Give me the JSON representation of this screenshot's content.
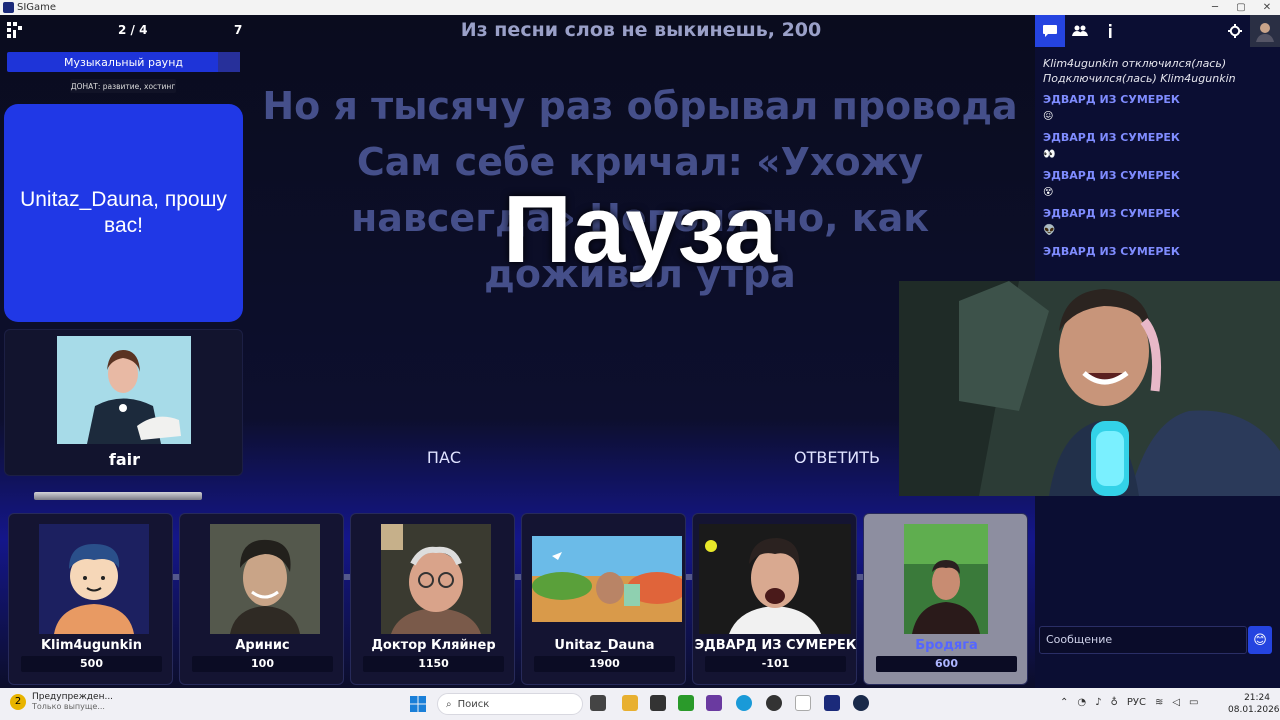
{
  "window": {
    "title": "SIGame"
  },
  "header": {
    "round_counter": "2 / 4",
    "round_total": "7",
    "theme_title": "Из песни слов не выкинешь, 200"
  },
  "left_panel": {
    "round_name": "Музыкальный раунд",
    "donate": "ДОНАТ: развитие, хостинг",
    "showman_message": "Unitaz_Dauna, прошу вас!",
    "showman_name": "fair"
  },
  "question": {
    "text": "Но я тысячу раз обрывал провода Сам себе кричал: «Ухожу навсегда» Непонятно, как доживал утра"
  },
  "overlay": {
    "pause": "Пауза"
  },
  "actions": {
    "pass_label": "ПАС",
    "answer_label": "ОТВЕТИТЬ"
  },
  "players": [
    {
      "name": "Klim4ugunkin",
      "score": "500"
    },
    {
      "name": "Аринис",
      "score": "100"
    },
    {
      "name": "Доктор Кляйнер",
      "score": "1150"
    },
    {
      "name": "Unitaz_Dauna",
      "score": "1900"
    },
    {
      "name": "ЭДВАРД ИЗ СУМЕРЕК",
      "score": "-101"
    },
    {
      "name": "Бродяга",
      "score": "600",
      "active": true
    }
  ],
  "chat": {
    "tabs": [
      "chat-icon",
      "users-icon",
      "info-icon",
      "gear-icon"
    ],
    "messages": [
      {
        "type": "system",
        "text": "Klim4ugunkin отключился(лась)"
      },
      {
        "type": "system",
        "text": "Подключился(лась) Klim4ugunkin"
      },
      {
        "type": "user",
        "author": "ЭДВАРД ИЗ СУМЕРЕК",
        "text": "😖"
      },
      {
        "type": "user",
        "author": "ЭДВАРД ИЗ СУМЕРЕК",
        "text": "👀"
      },
      {
        "type": "user",
        "author": "ЭДВАРД ИЗ СУМЕРЕК",
        "text": "😵"
      },
      {
        "type": "user",
        "author": "ЭДВАРД ИЗ СУМЕРЕК",
        "text": "👽"
      },
      {
        "type": "user",
        "author": "ЭДВАРД ИЗ СУМЕРЕК",
        "text": ""
      }
    ],
    "input_placeholder": "Сообщение"
  },
  "taskbar": {
    "notice_title": "Предупрежден...",
    "notice_subtitle": "Только выпуще...",
    "notice_count": "2",
    "search_label": "Поиск",
    "language": "РУС",
    "time": "21:24",
    "date": "08.01.2026"
  },
  "colors": {
    "accent": "#2038e6",
    "background": "#0b0d2a",
    "chat_author": "#7f8cff"
  }
}
